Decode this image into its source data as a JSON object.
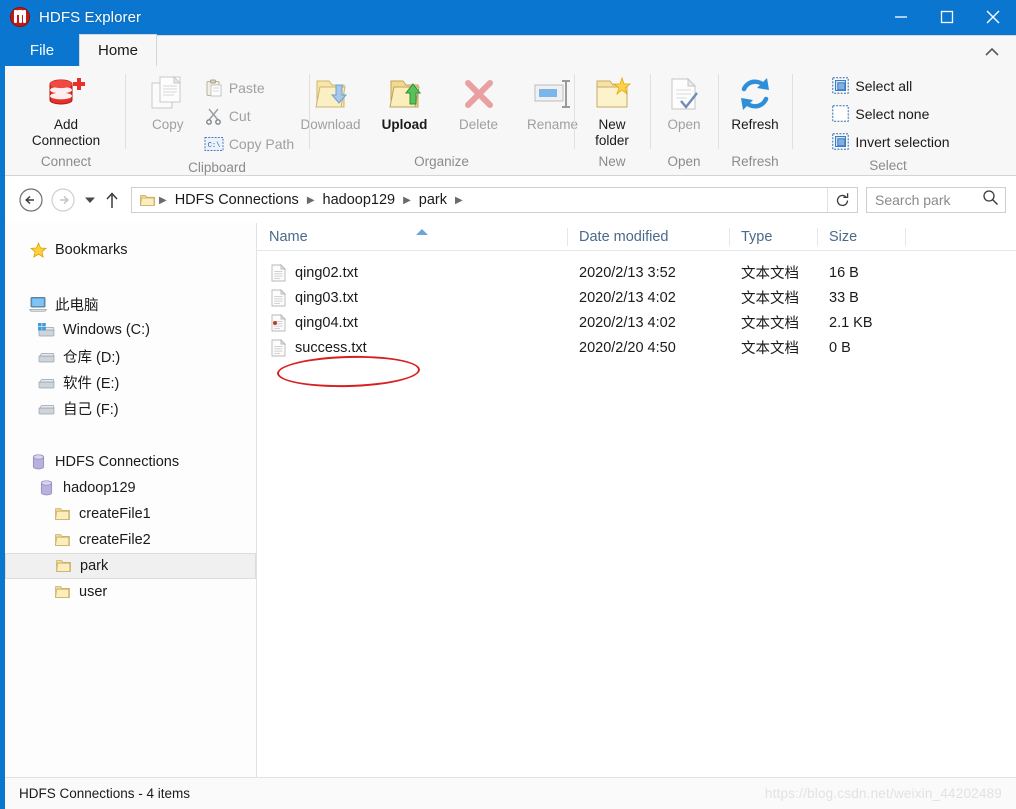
{
  "window": {
    "title": "HDFS Explorer",
    "app_icon": "hadoop-elephant-icon",
    "titlebar_color": "#0a76d0",
    "controls": {
      "minimize": "minimize-icon",
      "maximize": "maximize-icon",
      "close": "close-icon"
    }
  },
  "tabs": [
    {
      "label": "File",
      "active": false
    },
    {
      "label": "Home",
      "active": true
    }
  ],
  "ribbon": {
    "collapse_icon": "chevron-up-icon",
    "groups": [
      {
        "label": "Connect",
        "buttons": [
          {
            "label": "Add\nConnection",
            "label_line1": "Add",
            "label_line2": "Connection",
            "icon": "add-connection-icon",
            "disabled": false
          }
        ]
      },
      {
        "label": "Clipboard",
        "buttons": [
          {
            "label": "Copy",
            "icon": "copy-icon",
            "disabled": true
          }
        ],
        "small_buttons": [
          {
            "label": "Paste",
            "icon": "paste-icon",
            "disabled": true
          },
          {
            "label": "Cut",
            "icon": "cut-icon",
            "disabled": true
          },
          {
            "label": "Copy Path",
            "icon": "copy-path-icon",
            "disabled": true
          }
        ]
      },
      {
        "label": "Organize",
        "buttons": [
          {
            "label": "Download",
            "icon": "download-folder-icon",
            "disabled": true
          },
          {
            "label": "Upload",
            "icon": "upload-folder-icon",
            "disabled": false
          },
          {
            "label": "Delete",
            "icon": "delete-x-icon",
            "disabled": true
          },
          {
            "label": "Rename",
            "icon": "rename-icon",
            "disabled": true
          }
        ]
      },
      {
        "label": "New",
        "buttons": [
          {
            "label_line1": "New",
            "label_line2": "folder",
            "icon": "new-folder-icon",
            "disabled": false
          }
        ]
      },
      {
        "label": "Open",
        "buttons": [
          {
            "label": "Open",
            "icon": "open-document-icon",
            "disabled": true
          }
        ]
      },
      {
        "label": "Refresh",
        "buttons": [
          {
            "label": "Refresh",
            "icon": "refresh-icon",
            "disabled": false
          }
        ]
      },
      {
        "label": "Select",
        "small_buttons": [
          {
            "label": "Select all",
            "icon": "select-all-icon",
            "disabled": false
          },
          {
            "label": "Select none",
            "icon": "select-none-icon",
            "disabled": false
          },
          {
            "label": "Invert selection",
            "icon": "invert-selection-icon",
            "disabled": false
          }
        ]
      }
    ]
  },
  "nav": {
    "back_icon": "back-arrow-icon",
    "forward_icon": "forward-arrow-icon",
    "history_icon": "chevron-down-icon",
    "up_icon": "up-arrow-icon",
    "path_icon": "folder-icon",
    "breadcrumbs": [
      "HDFS Connections",
      "hadoop129",
      "park"
    ],
    "refresh_icon": "refresh-address-icon",
    "search": {
      "placeholder": "Search park",
      "icon": "search-icon"
    }
  },
  "sidebar": {
    "bookmarks": {
      "label": "Bookmarks",
      "icon": "star-icon"
    },
    "this_pc": {
      "label": "此电脑",
      "icon": "computer-icon"
    },
    "drives": [
      {
        "label": "Windows (C:)",
        "icon": "windows-drive-icon"
      },
      {
        "label": "仓库 (D:)",
        "icon": "drive-icon"
      },
      {
        "label": "软件 (E:)",
        "icon": "drive-icon"
      },
      {
        "label": "自己 (F:)",
        "icon": "drive-icon"
      }
    ],
    "hdfs_root": {
      "label": "HDFS Connections",
      "icon": "database-icon"
    },
    "connection": {
      "label": "hadoop129",
      "icon": "database-icon"
    },
    "folders": [
      {
        "label": "createFile1",
        "icon": "folder-icon",
        "selected": false
      },
      {
        "label": "createFile2",
        "icon": "folder-icon",
        "selected": false
      },
      {
        "label": "park",
        "icon": "folder-icon",
        "selected": true
      },
      {
        "label": "user",
        "icon": "folder-icon",
        "selected": false
      }
    ]
  },
  "filelist": {
    "columns": [
      "Name",
      "Date modified",
      "Type",
      "Size"
    ],
    "sort_column": "Name",
    "sort_direction": "ascending",
    "rows": [
      {
        "name": "qing02.txt",
        "date": "2020/2/13 3:52",
        "type": "文本文档",
        "size": "16 B",
        "icon": "text-file-icon",
        "marker": false,
        "annotated": false
      },
      {
        "name": "qing03.txt",
        "date": "2020/2/13 4:02",
        "type": "文本文档",
        "size": "33 B",
        "icon": "text-file-icon",
        "marker": false,
        "annotated": false
      },
      {
        "name": "qing04.txt",
        "date": "2020/2/13 4:02",
        "type": "文本文档",
        "size": "2.1 KB",
        "icon": "text-file-icon",
        "marker": true,
        "annotated": false
      },
      {
        "name": "success.txt",
        "date": "2020/2/20 4:50",
        "type": "文本文档",
        "size": "0 B",
        "icon": "text-file-icon",
        "marker": false,
        "annotated": true
      }
    ],
    "annotation_color": "#d81f1f"
  },
  "statusbar": {
    "text": "HDFS Connections - 4 items",
    "watermark": "https://blog.csdn.net/weixin_44202489"
  }
}
